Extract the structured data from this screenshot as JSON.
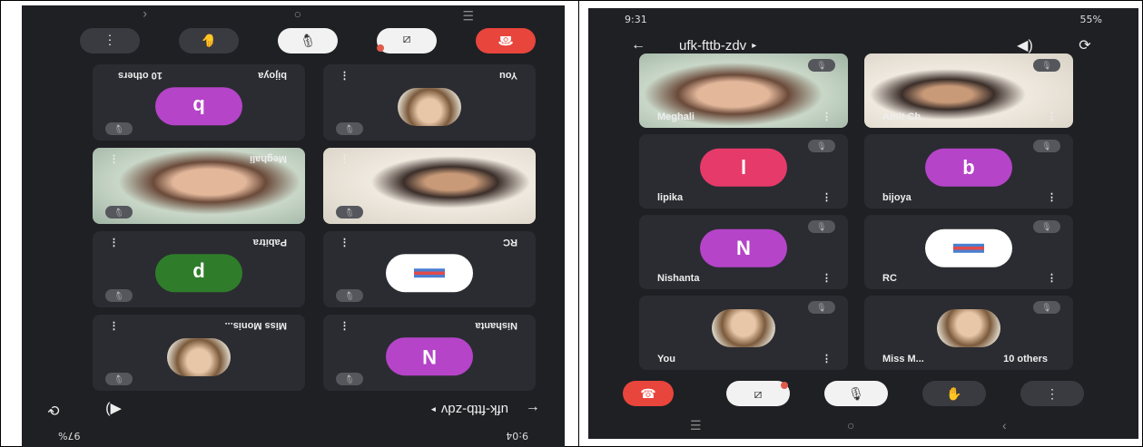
{
  "left": {
    "status": {
      "time": "9:04",
      "right": "97%"
    },
    "meeting_code": "ufk-fttb-zdv",
    "tiles": [
      {
        "name": "Nishanta",
        "initial": "N",
        "color": "#b544c9"
      },
      {
        "name": "Miss Monis...",
        "photo": true
      },
      {
        "name": "RC",
        "logo": true
      },
      {
        "name": "Pabitra",
        "initial": "p",
        "color": "#2f7d2a"
      },
      {
        "name": "",
        "video": "man"
      },
      {
        "name": "Meghali",
        "video": "woman"
      },
      {
        "name": "You",
        "photo": true
      },
      {
        "name": "bijoya",
        "initial": "b",
        "color": "#b544c9",
        "extra": "10 others"
      }
    ]
  },
  "right": {
    "status": {
      "time": "9:31",
      "right": "55%"
    },
    "meeting_code": "ufk-fttb-zdv",
    "tiles": [
      {
        "name": "Meghali",
        "video": "woman"
      },
      {
        "name": "Amit Ch",
        "video": "man"
      },
      {
        "name": "lipika",
        "initial": "l",
        "color": "#e63a6a"
      },
      {
        "name": "bijoya",
        "initial": "b",
        "color": "#b544c9"
      },
      {
        "name": "Nishanta",
        "initial": "N",
        "color": "#b544c9"
      },
      {
        "name": "RC",
        "logo": true
      },
      {
        "name": "You",
        "photo": true
      },
      {
        "name": "Miss M...",
        "photo": true,
        "extra": "10 others"
      }
    ]
  },
  "icons": {
    "end_call": "phone-hangup-icon",
    "camera_off": "camera-off-icon",
    "mic_off": "mic-off-icon",
    "raise_hand": "hand-icon",
    "more": "more-vert-icon"
  }
}
